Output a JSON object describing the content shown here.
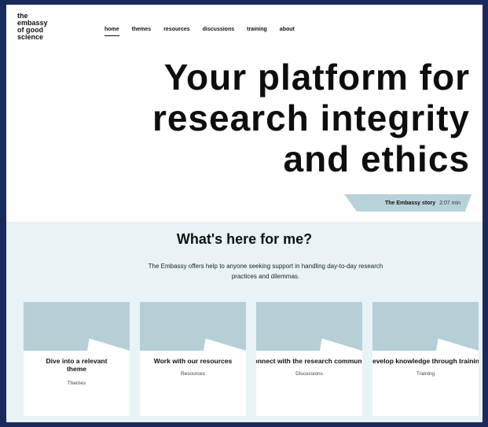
{
  "logo": {
    "lines": [
      "the",
      "embassy",
      "of good",
      "science"
    ]
  },
  "nav": {
    "items": [
      {
        "label": "home"
      },
      {
        "label": "themes"
      },
      {
        "label": "resources"
      },
      {
        "label": "discussions"
      },
      {
        "label": "training"
      },
      {
        "label": "about"
      }
    ],
    "active": "home"
  },
  "hero": {
    "lines": [
      "Your platform for",
      "research integrity",
      "and ethics"
    ]
  },
  "story": {
    "label": "The Embassy story",
    "duration": "2:07 min"
  },
  "intro": {
    "title": "What's here for me?",
    "description": "The Embassy offers help to anyone seeking support in handling day-to-day research practices and dilemmas."
  },
  "cards": [
    {
      "title": "Dive into a relevant theme",
      "subtitle": "Themes"
    },
    {
      "title": "Work with our resources",
      "subtitle": "Resources"
    },
    {
      "title": "Connect with the research community",
      "subtitle": "Discussions"
    },
    {
      "title": "Develop knowledge through training",
      "subtitle": "Training"
    }
  ],
  "colors": {
    "frame": "#1b2a5c",
    "section_bg": "#e8f3f6",
    "accent_band": "#b6cfd7"
  }
}
